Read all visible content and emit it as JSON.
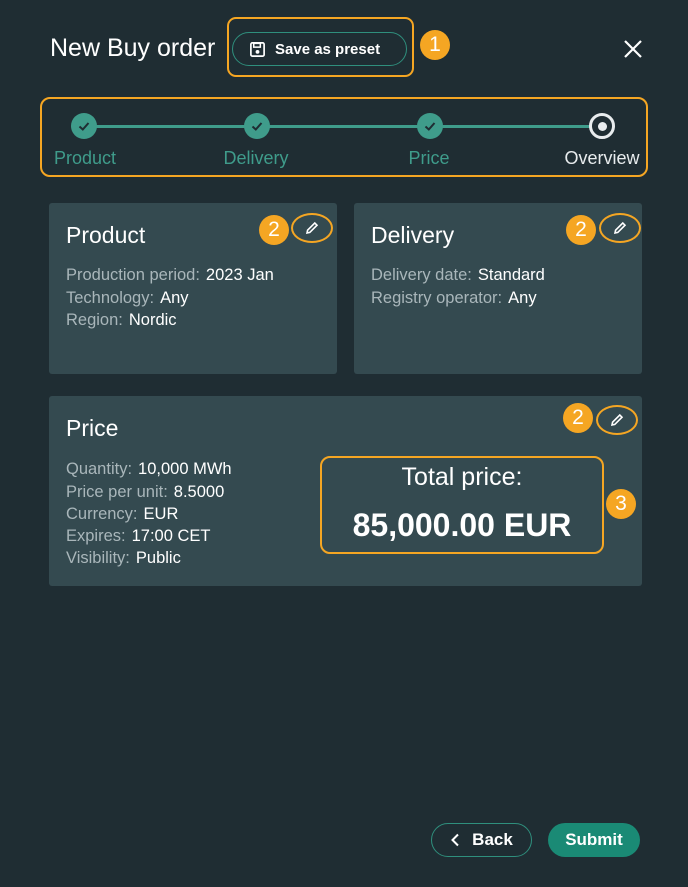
{
  "header": {
    "title": "New Buy order",
    "preset_label": "Save as preset",
    "close_icon": "close-icon"
  },
  "annotations": {
    "one": "1",
    "two": "2",
    "three": "3"
  },
  "stepper": {
    "steps": [
      {
        "label": "Product",
        "state": "done"
      },
      {
        "label": "Delivery",
        "state": "done"
      },
      {
        "label": "Price",
        "state": "done"
      },
      {
        "label": "Overview",
        "state": "current"
      }
    ]
  },
  "product": {
    "title": "Product",
    "rows": [
      {
        "key": "Production period:",
        "value": "2023 Jan"
      },
      {
        "key": "Technology:",
        "value": "Any"
      },
      {
        "key": "Region:",
        "value": "Nordic"
      }
    ]
  },
  "delivery": {
    "title": "Delivery",
    "rows": [
      {
        "key": "Delivery date:",
        "value": "Standard"
      },
      {
        "key": "Registry operator:",
        "value": "Any"
      }
    ]
  },
  "price": {
    "title": "Price",
    "rows": [
      {
        "key": "Quantity:",
        "value": "10,000 MWh"
      },
      {
        "key": "Price per unit:",
        "value": "8.5000"
      },
      {
        "key": "Currency:",
        "value": "EUR"
      },
      {
        "key": "Expires:",
        "value": "17:00 CET"
      },
      {
        "key": "Visibility:",
        "value": "Public"
      }
    ],
    "total_label": "Total price:",
    "total_value": "85,000.00 EUR"
  },
  "footer": {
    "back_label": "Back",
    "submit_label": "Submit"
  },
  "colors": {
    "accent": "#3f9c8b",
    "highlight": "#f5a623",
    "background": "#1f2d33",
    "card": "#344a50"
  }
}
